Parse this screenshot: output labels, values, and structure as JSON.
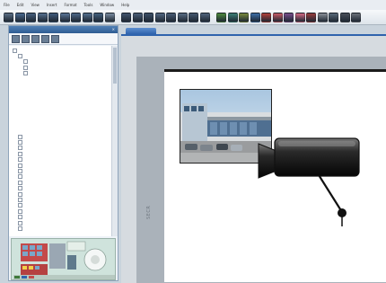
{
  "menubar": [
    "File",
    "Edit",
    "View",
    "Insert",
    "Format",
    "Tools",
    "Window",
    "Help"
  ],
  "toolbar": {
    "buttons": [
      {
        "name": "new",
        "color": "#5b6f86"
      },
      {
        "name": "open",
        "color": "#4a6a90"
      },
      {
        "name": "save",
        "color": "#47607f"
      },
      {
        "name": "print",
        "color": "#56708f"
      },
      {
        "name": "cut",
        "color": "#3f5b7c"
      },
      {
        "name": "copy",
        "color": "#5a7596"
      },
      {
        "name": "paste",
        "color": "#4d6889"
      },
      {
        "name": "undo",
        "color": "#54708f"
      },
      {
        "name": "redo",
        "color": "#45617f"
      },
      {
        "name": "zoom",
        "color": "#7a8ba0"
      },
      {
        "name": "align-left",
        "color": "#41556d",
        "sep": true
      },
      {
        "name": "align-center",
        "color": "#4b5f78"
      },
      {
        "name": "align-right",
        "color": "#3d5168"
      },
      {
        "name": "distribute",
        "color": "#536782"
      },
      {
        "name": "group",
        "color": "#4a5d75"
      },
      {
        "name": "ungroup",
        "color": "#5a6d84"
      },
      {
        "name": "rotate",
        "color": "#46596f"
      },
      {
        "name": "flip",
        "color": "#51647c"
      },
      {
        "name": "layer-green",
        "color": "#4e8a3d",
        "sep": true
      },
      {
        "name": "layer-teal",
        "color": "#3c7f74"
      },
      {
        "name": "layer-olive",
        "color": "#7a8a3a"
      },
      {
        "name": "layer-blue",
        "color": "#3d6fa8"
      },
      {
        "name": "layer-red",
        "color": "#b5413a"
      },
      {
        "name": "layer-rose",
        "color": "#c95b66"
      },
      {
        "name": "layer-purple",
        "color": "#7a4f8c"
      },
      {
        "name": "layer-pink",
        "color": "#d46a84"
      },
      {
        "name": "layer-maroon",
        "color": "#9a3d3d"
      },
      {
        "name": "layer-gray",
        "color": "#8a8f96"
      },
      {
        "name": "layer-steel",
        "color": "#5a6a7a"
      },
      {
        "name": "layer-dark",
        "color": "#4a4f58"
      },
      {
        "name": "layer-last",
        "color": "#6b7078"
      }
    ]
  },
  "sidebar": {
    "title": "",
    "tree": [
      {
        "label": "",
        "level": 0,
        "expander": true
      },
      {
        "label": "",
        "level": 1,
        "expander": true
      },
      {
        "label": "",
        "level": 2,
        "expander": true
      },
      {
        "label": "",
        "level": 2,
        "expander": true
      },
      {
        "label": "",
        "level": 2,
        "expander": true
      },
      {
        "label": "",
        "level": 3,
        "expander": false,
        "selected": true
      },
      {
        "label": "",
        "level": 3,
        "expander": false
      },
      {
        "label": "",
        "level": 3,
        "expander": false
      },
      {
        "label": "",
        "level": 3,
        "expander": false
      },
      {
        "label": "",
        "level": 3,
        "expander": false
      },
      {
        "label": "",
        "level": 3,
        "expander": false
      },
      {
        "label": "",
        "level": 3,
        "expander": false
      },
      {
        "label": "",
        "level": 3,
        "expander": false
      },
      {
        "label": "",
        "level": 3,
        "expander": false
      },
      {
        "label": "",
        "level": 3,
        "expander": false
      },
      {
        "label": "",
        "level": 1,
        "expander": true
      },
      {
        "label": "",
        "level": 1,
        "expander": true
      },
      {
        "label": "",
        "level": 1,
        "expander": true
      },
      {
        "label": "",
        "level": 1,
        "expander": true
      },
      {
        "label": "",
        "level": 1,
        "expander": true
      },
      {
        "label": "",
        "level": 1,
        "expander": true
      },
      {
        "label": "",
        "level": 1,
        "expander": true
      },
      {
        "label": "",
        "level": 1,
        "expander": true
      },
      {
        "label": "",
        "level": 1,
        "expander": true
      },
      {
        "label": "",
        "level": 1,
        "expander": true
      },
      {
        "label": "",
        "level": 1,
        "expander": true
      },
      {
        "label": "",
        "level": 1,
        "expander": true
      },
      {
        "label": "",
        "level": 1,
        "expander": true
      },
      {
        "label": "",
        "level": 1,
        "expander": true
      },
      {
        "label": "",
        "level": 1,
        "expander": true
      },
      {
        "label": "",
        "level": 1,
        "expander": true
      },
      {
        "label": "",
        "level": 1,
        "expander": true
      }
    ]
  },
  "document_tab": {
    "label": ""
  },
  "canvas": {
    "vertical_label": "SECR"
  },
  "colors": {
    "accent": "#2f63ad",
    "selection": "#2d62b8",
    "page_border": "#1b1b1b"
  }
}
